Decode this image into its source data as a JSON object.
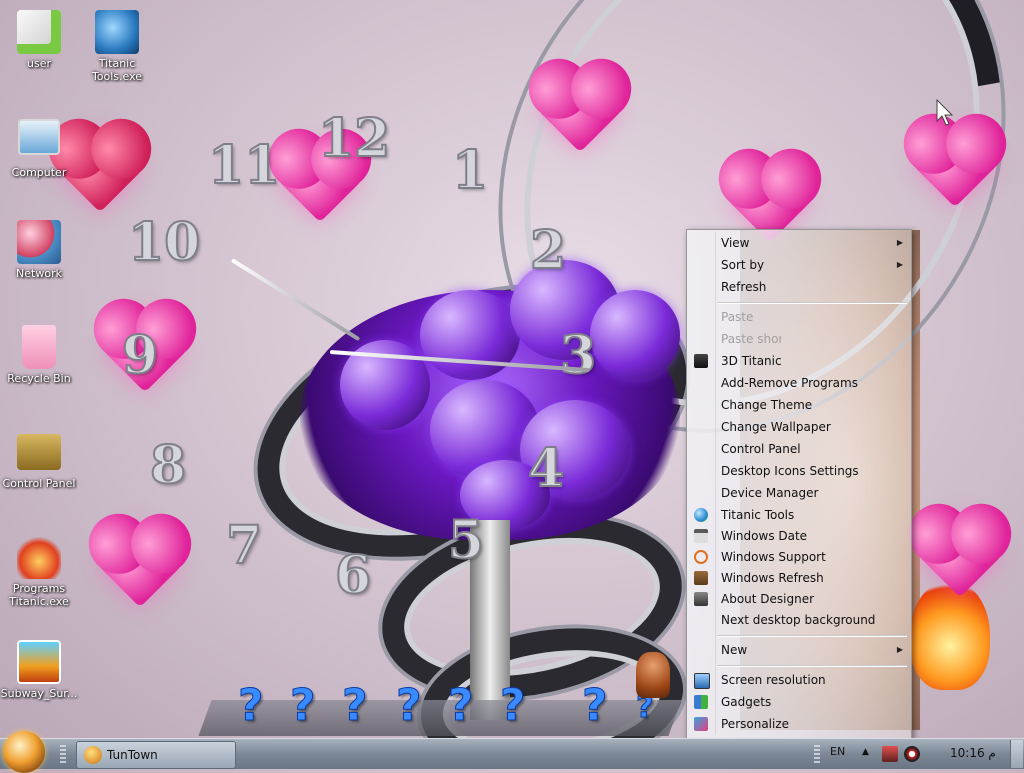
{
  "desktop": {
    "icons": [
      {
        "label": "user",
        "icon": "folder-icon",
        "color": "#e8e8e8"
      },
      {
        "label": "Titanic Tools.exe",
        "icon": "tools-app-icon",
        "color": "#3aa0e0"
      },
      {
        "label": "Computer",
        "icon": "computer-icon",
        "color": "#4a90c8"
      },
      {
        "label": "Network",
        "icon": "network-icon",
        "color": "#d04060"
      },
      {
        "label": "Recycle Bin",
        "icon": "recycle-bin-icon",
        "color": "#f0a0c0"
      },
      {
        "label": "Control Panel",
        "icon": "control-panel-icon",
        "color": "#8a6a20"
      },
      {
        "label": "Programs Titanic.exe",
        "icon": "programs-app-icon",
        "color": "#e04020"
      },
      {
        "label": "Subway_Sur...",
        "icon": "subway-game-icon",
        "color": "#f0a020"
      }
    ],
    "clock_numbers": [
      "12",
      "1",
      "2",
      "3",
      "4",
      "5",
      "6",
      "7",
      "8",
      "9",
      "10",
      "11"
    ]
  },
  "context_menu": {
    "items": [
      {
        "label": "View",
        "submenu": true,
        "disabled": false
      },
      {
        "label": "Sort by",
        "submenu": true,
        "disabled": false
      },
      {
        "label": "Refresh",
        "submenu": false,
        "disabled": false
      },
      {
        "label": "Paste",
        "submenu": false,
        "disabled": true
      },
      {
        "label": "Paste shortcut",
        "submenu": false,
        "disabled": true
      },
      {
        "label": "3D Titanic",
        "submenu": false,
        "disabled": false,
        "icon": "titanic-3d-icon"
      },
      {
        "label": "Add-Remove Programs",
        "submenu": false,
        "disabled": false
      },
      {
        "label": "Change Theme",
        "submenu": false,
        "disabled": false
      },
      {
        "label": "Change Wallpaper",
        "submenu": false,
        "disabled": false
      },
      {
        "label": "Control Panel",
        "submenu": false,
        "disabled": false
      },
      {
        "label": "Desktop Icons Settings",
        "submenu": false,
        "disabled": false
      },
      {
        "label": "Device Manager",
        "submenu": false,
        "disabled": false
      },
      {
        "label": "Titanic Tools",
        "submenu": false,
        "disabled": false,
        "icon": "globe-icon"
      },
      {
        "label": "Windows Date",
        "submenu": false,
        "disabled": false,
        "icon": "calendar-icon"
      },
      {
        "label": "Windows Support",
        "submenu": false,
        "disabled": false,
        "icon": "support-icon"
      },
      {
        "label": "Windows Refresh",
        "submenu": false,
        "disabled": false,
        "icon": "refresh-icon"
      },
      {
        "label": "About Designer",
        "submenu": false,
        "disabled": false,
        "icon": "designer-icon"
      },
      {
        "label": "Next desktop background",
        "submenu": false,
        "disabled": false
      },
      {
        "label": "New",
        "submenu": true,
        "disabled": false
      },
      {
        "label": "Screen resolution",
        "submenu": false,
        "disabled": false,
        "icon": "display-icon"
      },
      {
        "label": "Gadgets",
        "submenu": false,
        "disabled": false,
        "icon": "gadgets-icon"
      },
      {
        "label": "Personalize",
        "submenu": false,
        "disabled": false,
        "icon": "personalize-icon"
      }
    ]
  },
  "taskbar": {
    "button_label": "TunTown",
    "language": "EN",
    "clock": "10:16 م",
    "up_arrow": "▲"
  },
  "colors": {
    "taskbar": "#7c8896",
    "heart_pink": "#e0239a",
    "glass_purple": "#6a18c0"
  }
}
